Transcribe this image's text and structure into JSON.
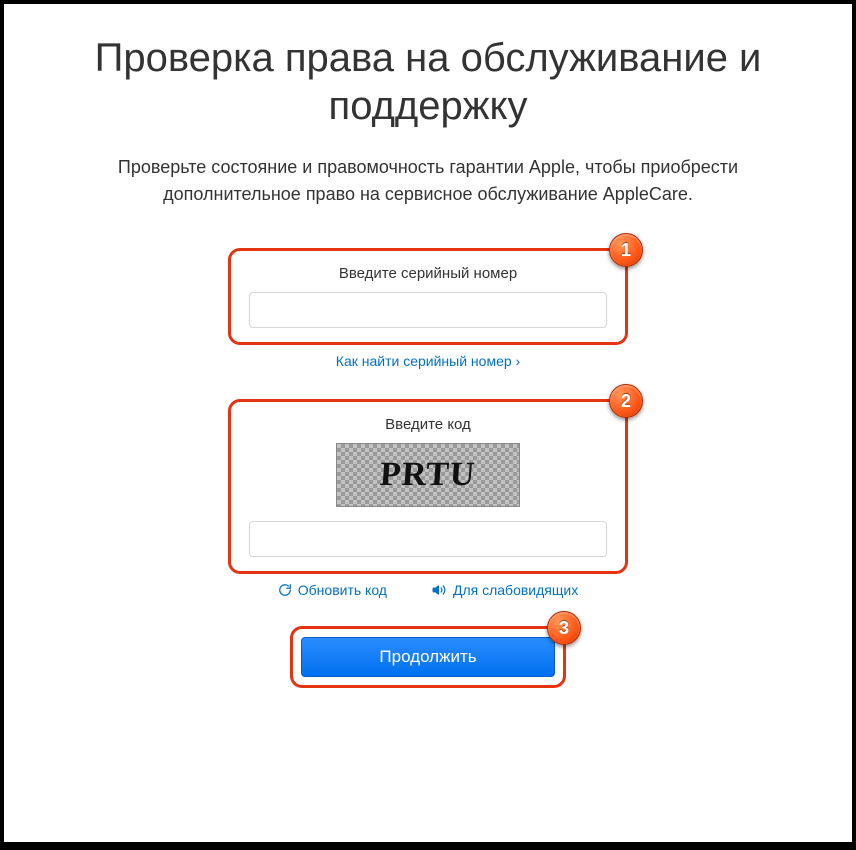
{
  "title": "Проверка права на обслуживание и поддержку",
  "subtitle": "Проверьте состояние и правомочность гарантии Apple, чтобы приобрести дополнительное право на сервисное обслуживание AppleCare.",
  "serial": {
    "label": "Введите серийный номер",
    "value": "",
    "help_link": "Как найти серийный номер ›"
  },
  "captcha": {
    "label": "Введите код",
    "image_text": "PRTU",
    "value": "",
    "refresh_label": "Обновить код",
    "accessibility_label": "Для слабовидящих"
  },
  "submit": {
    "label": "Продолжить"
  },
  "badges": {
    "one": "1",
    "two": "2",
    "three": "3"
  }
}
